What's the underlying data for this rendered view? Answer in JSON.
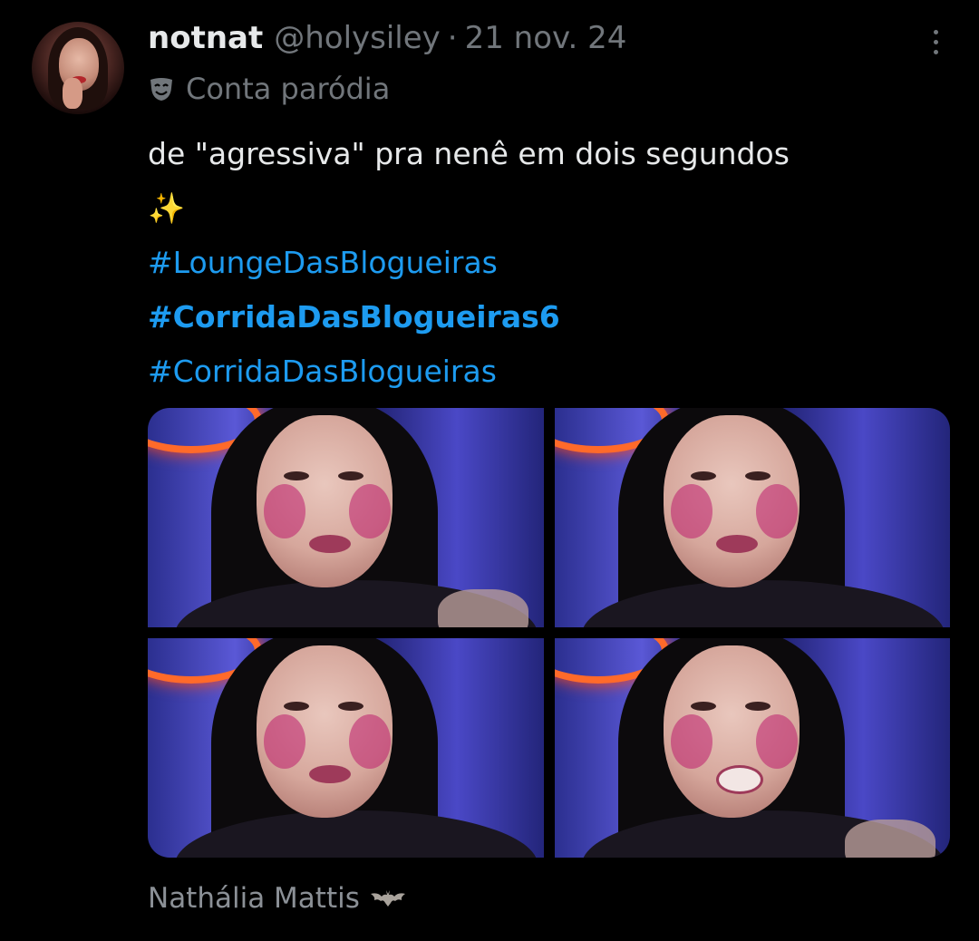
{
  "author": {
    "display_name": "notnat",
    "handle": "@holysiley",
    "separator": "·",
    "date": "21 nov. 24",
    "avatar_icon": "profile-avatar"
  },
  "label": {
    "icon": "parody-mask-icon",
    "text": "Conta paródia"
  },
  "tweet": {
    "line1": "de \"agressiva\" pra nenê em dois segundos",
    "line2": "✨",
    "hashtags": [
      {
        "text": "#LoungeDasBlogueiras",
        "bold": false
      },
      {
        "text": "#CorridaDasBlogueiras6",
        "bold": true
      },
      {
        "text": "#CorridaDasBlogueiras",
        "bold": false
      }
    ]
  },
  "media": {
    "count": 4,
    "caption": "Nathália Mattis",
    "caption_icon": "bat-icon"
  },
  "colors": {
    "background": "#000000",
    "text": "#e7e9ea",
    "secondary": "#71767b",
    "link": "#1d9bf0"
  }
}
